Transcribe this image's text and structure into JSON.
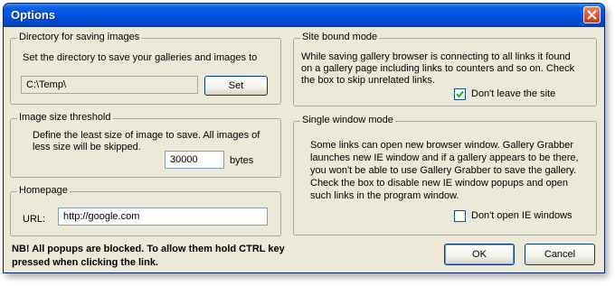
{
  "window": {
    "title": "Options"
  },
  "directory": {
    "legend": "Directory for saving images",
    "description": "Set the directory to save your galleries and images to",
    "path_value": "C:\\Temp\\",
    "set_label": "Set"
  },
  "threshold": {
    "legend": "Image size threshold",
    "description_line1": "Define the least size of image to save. All images of",
    "description_line2": "less size will be skipped.",
    "size_value": "30000",
    "unit": "bytes"
  },
  "homepage": {
    "legend": "Homepage",
    "url_label": "URL:",
    "url_value": "http://google.com"
  },
  "site_bound": {
    "legend": "Site bound mode",
    "line1": "While saving gallery browser is connecting to all links it found",
    "line2": "on a gallery page including links to counters and so on. Check",
    "line3": "the box to skip unrelated links.",
    "checkbox_label": "Don't leave the site",
    "checked": true
  },
  "single_window": {
    "legend": "Single window mode",
    "line1": "Some links can open new browser window. Gallery Grabber",
    "line2": "launches new IE window and if a gallery appears to be there,",
    "line3": " you won't be able to use Gallery Grabber to save  the gallery.",
    "line4": "Check the box to disable new IE window popups and open",
    "line5": "such links in the program window.",
    "checkbox_label": "Don't open IE windows",
    "checked": false
  },
  "footer": {
    "note_line1": "NB! All popups are blocked. To allow them hold CTRL key",
    "note_line2": "pressed when clicking the link.",
    "ok_label": "OK",
    "cancel_label": "Cancel"
  }
}
